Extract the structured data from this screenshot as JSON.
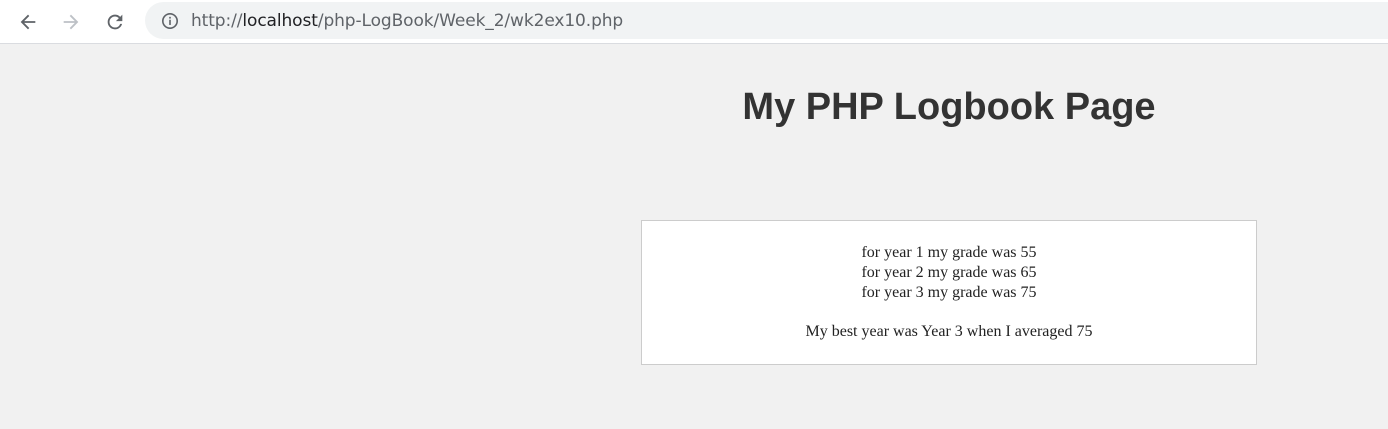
{
  "browser": {
    "url_scheme": "http://",
    "url_host": "localhost",
    "url_path": "/php-LogBook/Week_2/wk2ex10.php",
    "icons": [
      "back-arrow-icon",
      "forward-arrow-icon",
      "reload-icon",
      "info-icon"
    ],
    "colors": {
      "toolbar": "#ffffff",
      "omnibox": "#f1f3f4",
      "forward_disabled": "#bdc1c6"
    }
  },
  "page": {
    "title": "My PHP Logbook Page",
    "grades": [
      "for year 1 my grade was 55",
      "for year 2 my grade was 65",
      "for year 3 my grade was 75"
    ],
    "best": "My best year was Year 3 when I averaged 75",
    "colors": {
      "background": "#f1f1f1",
      "title": "#333333",
      "box": "#ffffff",
      "box_border": "#cccccc"
    }
  }
}
